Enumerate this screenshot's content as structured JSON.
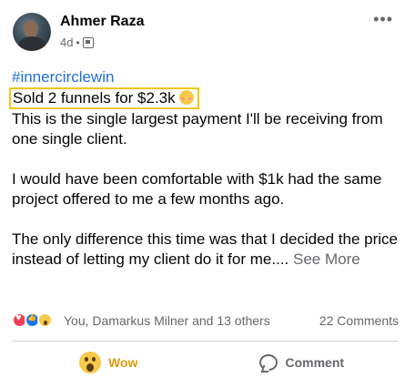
{
  "post": {
    "author": "Ahmer Raza",
    "time": "4d",
    "separator": "•",
    "more_icon": "•••",
    "hashtag": "#innercirclewin",
    "highlight_text": "Sold 2 funnels for $2.3k",
    "paragraphs": [
      "This is the single largest payment I'll be receiving from one single client.",
      "I would have been comfortable with $1k had the same project offered to me a few months ago.",
      "The only difference this time was that I decided the price instead of letting my client do it for me...."
    ],
    "see_more": "See More"
  },
  "reactions": {
    "icons": [
      "love-icon",
      "like-icon",
      "wow-icon"
    ],
    "names": "You, Damarkus Milner and 13 others",
    "comments": "22 Comments"
  },
  "actions": {
    "wow_label": "Wow",
    "comment_label": "Comment"
  },
  "colors": {
    "hashtag": "#216fdb",
    "highlight_border": "#f2c615",
    "wow_active": "#e09a0b",
    "secondary_text": "#65676b"
  }
}
